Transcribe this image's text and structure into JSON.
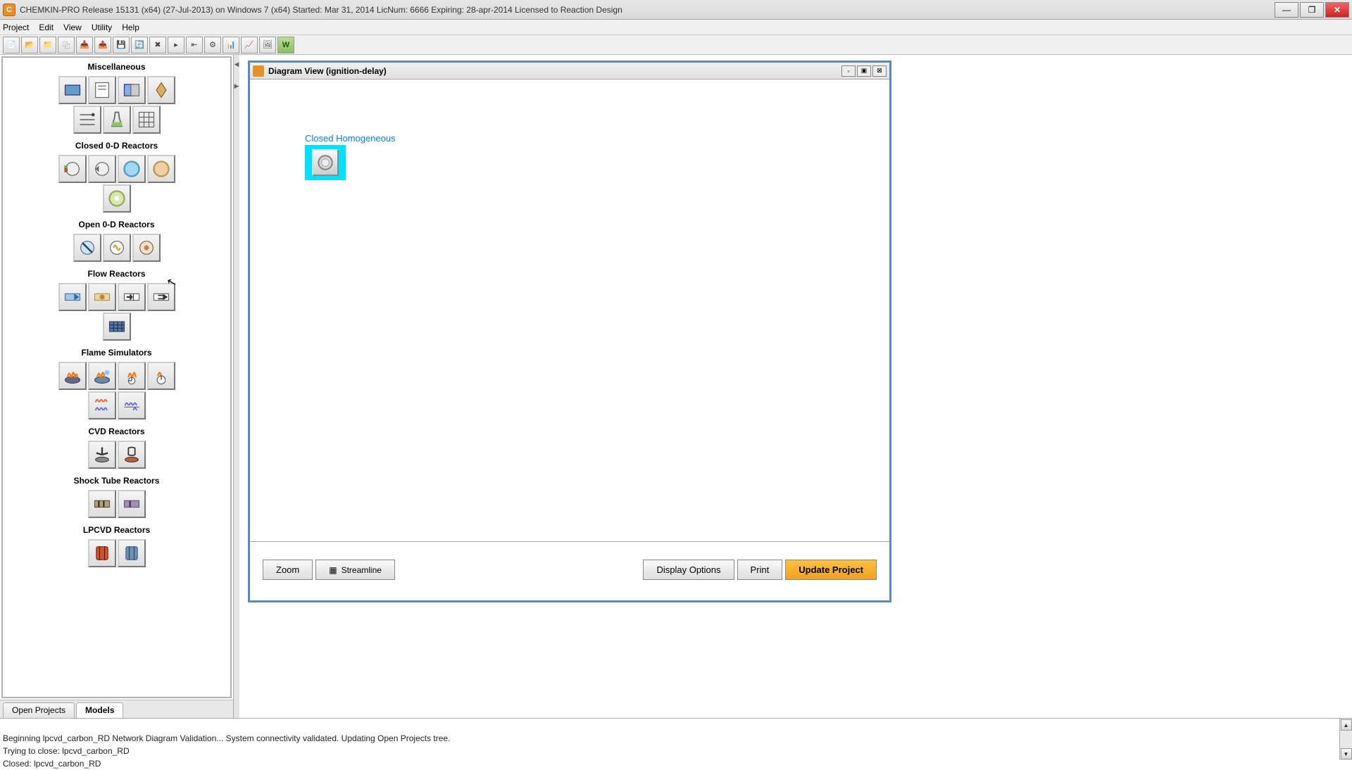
{
  "title": "CHEMKIN-PRO Release 15131 (x64) (27-Jul-2013) on Windows 7 (x64)    Started: Mar 31, 2014    LicNum: 6666  Expiring: 28-apr-2014   Licensed to Reaction Design",
  "menu": {
    "project": "Project",
    "edit": "Edit",
    "view": "View",
    "utility": "Utility",
    "help": "Help"
  },
  "palette": {
    "sections": [
      {
        "title": "Miscellaneous",
        "count": 7
      },
      {
        "title": "Closed 0-D Reactors",
        "count": 5
      },
      {
        "title": "Open 0-D Reactors",
        "count": 3
      },
      {
        "title": "Flow Reactors",
        "count": 5
      },
      {
        "title": "Flame Simulators",
        "count": 6
      },
      {
        "title": "CVD Reactors",
        "count": 2
      },
      {
        "title": "Shock Tube Reactors",
        "count": 2
      },
      {
        "title": "LPCVD Reactors",
        "count": 2
      }
    ]
  },
  "tabs": {
    "open_projects": "Open Projects",
    "models": "Models"
  },
  "diagram": {
    "title": "Diagram View  (ignition-delay)",
    "node_label": "Closed Homogeneous",
    "buttons": {
      "zoom": "Zoom",
      "streamline": "Streamline",
      "display": "Display Options",
      "print": "Print",
      "update": "Update Project"
    }
  },
  "log": "Beginning lpcvd_carbon_RD Network Diagram Validation...  System connectivity validated.  Updating Open Projects tree.\nTrying to close: lpcvd_carbon_RD\nClosed: lpcvd_carbon_RD",
  "toolbar_icon": "W"
}
